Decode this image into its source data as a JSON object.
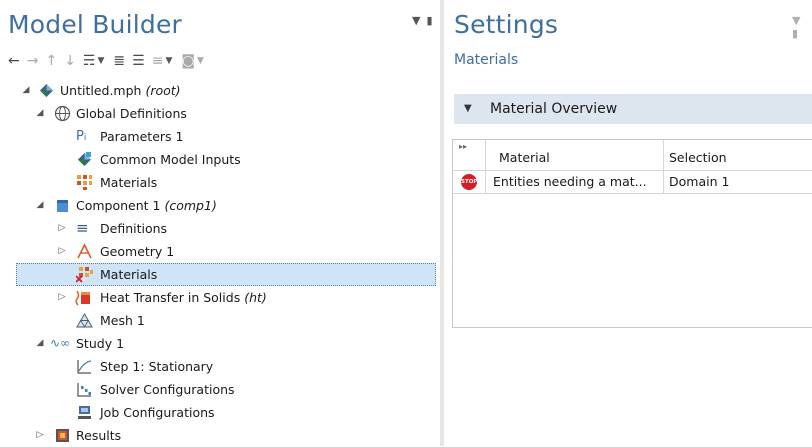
{
  "model_builder": {
    "title": "Model Builder",
    "toolbar_icons": [
      "arrow-left-icon",
      "arrow-right-icon",
      "arrow-up-icon",
      "arrow-down-icon",
      "show-icon",
      "expand-icon",
      "collapse-icon",
      "list-icon",
      "camera-icon"
    ],
    "tree": [
      {
        "label": "Untitled.mph",
        "tag": "(root)",
        "icon": "model-icon",
        "toggle": "expanded"
      },
      {
        "label": "Global Definitions",
        "icon": "globe-icon",
        "toggle": "expanded"
      },
      {
        "label": "Parameters 1",
        "icon": "parameters-icon"
      },
      {
        "label": "Common Model Inputs",
        "icon": "model-inputs-icon"
      },
      {
        "label": "Materials",
        "icon": "materials-icon"
      },
      {
        "label": "Component 1",
        "tag": "(comp1)",
        "icon": "component-icon",
        "toggle": "expanded"
      },
      {
        "label": "Definitions",
        "icon": "definitions-icon",
        "toggle": "collapsed"
      },
      {
        "label": "Geometry 1",
        "icon": "geometry-icon",
        "toggle": "collapsed"
      },
      {
        "label": "Materials",
        "icon": "materials-error-icon",
        "selected": true
      },
      {
        "label": "Heat Transfer in Solids",
        "tag": "(ht)",
        "icon": "heat-transfer-icon",
        "toggle": "collapsed"
      },
      {
        "label": "Mesh 1",
        "icon": "mesh-icon"
      },
      {
        "label": "Study 1",
        "icon": "study-icon",
        "toggle": "expanded"
      },
      {
        "label": "Step 1: Stationary",
        "icon": "stationary-step-icon"
      },
      {
        "label": "Solver Configurations",
        "icon": "solver-icon"
      },
      {
        "label": "Job Configurations",
        "icon": "job-icon"
      },
      {
        "label": "Results",
        "icon": "results-icon",
        "toggle": "collapsed"
      }
    ]
  },
  "settings": {
    "title": "Settings",
    "subtitle": "Materials",
    "section": "Material Overview",
    "columns": [
      "Material",
      "Selection"
    ],
    "rows": [
      {
        "status_icon": "stop-icon",
        "status_text": "STOP",
        "material": "Entities needing a mat...",
        "selection": "Domain 1"
      }
    ]
  },
  "colors": {
    "title": "#3f6f9e",
    "selection": "#cfe4f7",
    "section_header": "#dde5ef",
    "stop": "#d21f26"
  }
}
